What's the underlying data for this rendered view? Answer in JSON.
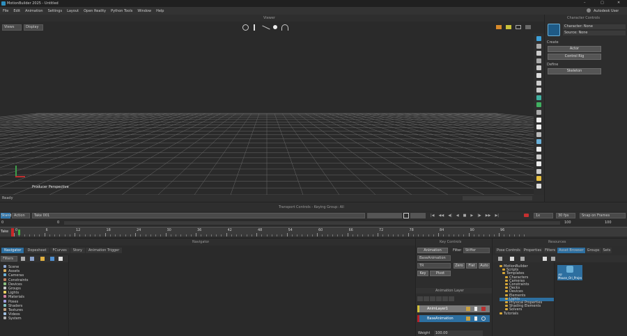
{
  "app": {
    "title": "MotionBuilder 2025 - Untitled"
  },
  "window_controls": {
    "minimize": "–",
    "maximize": "□",
    "close": "✕"
  },
  "menu": [
    "File",
    "Edit",
    "Animation",
    "Settings",
    "Layout",
    "Open Reality",
    "Python Tools",
    "Window",
    "Help"
  ],
  "user": {
    "label": "Autodesk User"
  },
  "viewer": {
    "header": "Viewer",
    "left_menus": [
      "Views",
      "Display"
    ],
    "camera_label": "Producer Perspective",
    "status": "Ready"
  },
  "character_controls": {
    "header": "Character Controls",
    "character": "Character: None",
    "source": "Source: None",
    "create_label": "Create",
    "actor_btn": "Actor",
    "control_rig_btn": "Control Rig",
    "define_label": "Define",
    "skeleton_btn": "Skeleton"
  },
  "transport": {
    "header": "Transport Controls - Keying Group: All",
    "take_mode": "Stand",
    "edit_mode": "Action",
    "take": "Take 001",
    "start_frame": "0",
    "current_frame": "0",
    "end_frame": "100",
    "end_frame2": "100",
    "fps": "30 fps",
    "play_mode": "Snap on Frames",
    "step": "1x",
    "ruler_ticks": [
      "0",
      "6",
      "12",
      "18",
      "24",
      "30",
      "36",
      "42",
      "48",
      "54",
      "60",
      "66",
      "72",
      "78",
      "84",
      "90",
      "96"
    ],
    "timeline_label": "Take",
    "frame_marker": "0"
  },
  "navigator": {
    "header": "Navigator",
    "tabs": [
      "Navigator",
      "Dopesheet",
      "FCurves",
      "Story",
      "Animation Trigger"
    ],
    "filter": "Filters",
    "items": [
      "Scene",
      "Assets",
      "Cameras",
      "Constraints",
      "Devices",
      "Groups",
      "Lights",
      "Materials",
      "Poses",
      "Shaders",
      "Textures",
      "Videos",
      "System"
    ]
  },
  "key_controls": {
    "header": "Key Controls",
    "animation_btn": "Animation",
    "filter_label": "Filter",
    "filter_value": "Stiffer",
    "base_anim": "BaseAnimation",
    "key_label": "TR",
    "zero_btn": "Zero",
    "flat_btn": "Flat",
    "auto_btn": "Auto",
    "key_btn": "Key",
    "pivot_btn": "Pivot",
    "layers_header": "Animation Layer",
    "layer1": "AnimLayer1",
    "layer2": "BaseAnimation",
    "weight_label": "Weight",
    "weight_value": "100.00",
    "accent_yellow": "#d2c03a",
    "accent_red": "#b8202a"
  },
  "resources": {
    "header": "Resources",
    "tabs": [
      "Pose Controls",
      "Properties",
      "Filters",
      "Asset Browser",
      "Groups",
      "Sets"
    ],
    "tree": [
      "MotionBuilder",
      "Scripts",
      "Templates",
      "Characters",
      "Cameras",
      "Constraints",
      "Decks",
      "Devices",
      "Elements",
      "Lights",
      "Physical Properties",
      "Shading Elements",
      "Solvers",
      "Tutorials"
    ],
    "selected_index": 9,
    "asset_label": "3D Mouse_Ori_ProjectCameras"
  }
}
